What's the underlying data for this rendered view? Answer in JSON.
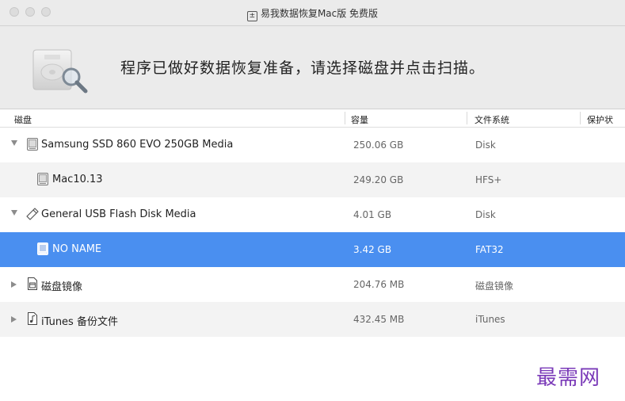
{
  "window": {
    "title": "易我数据恢复Mac版 免费版"
  },
  "header": {
    "message": "程序已做好数据恢复准备，请选择磁盘并点击扫描。"
  },
  "table": {
    "columns": {
      "disk": "磁盘",
      "capacity": "容量",
      "filesystem": "文件系统",
      "protection": "保护状"
    },
    "rows": [
      {
        "name": "Samsung SSD 860 EVO 250GB Media",
        "capacity": "250.06 GB",
        "filesystem": "Disk",
        "expander": "expanded",
        "icon": "drive-icon",
        "selected": false
      },
      {
        "name": "Mac10.13",
        "capacity": "249.20 GB",
        "filesystem": "HFS+",
        "expander": "none",
        "icon": "drive-icon",
        "selected": false
      },
      {
        "name": "General USB Flash Disk Media",
        "capacity": "4.01 GB",
        "filesystem": "Disk",
        "expander": "expanded",
        "icon": "usb-icon",
        "selected": false
      },
      {
        "name": "NO NAME",
        "capacity": "3.42 GB",
        "filesystem": "FAT32",
        "expander": "none",
        "icon": "drive-icon",
        "selected": true
      },
      {
        "name": "磁盘镜像",
        "capacity": "204.76 MB",
        "filesystem": "磁盘镜像",
        "expander": "collapsed",
        "icon": "disk-image-icon",
        "selected": false
      },
      {
        "name": "iTunes 备份文件",
        "capacity": "432.45 MB",
        "filesystem": "iTunes",
        "expander": "collapsed",
        "icon": "music-file-icon",
        "selected": false
      }
    ]
  },
  "watermark": {
    "text": "最需网"
  },
  "colors": {
    "selection": "#4a8ff0",
    "header_bg": "#ebebeb",
    "watermark": "#7a3ab8"
  }
}
